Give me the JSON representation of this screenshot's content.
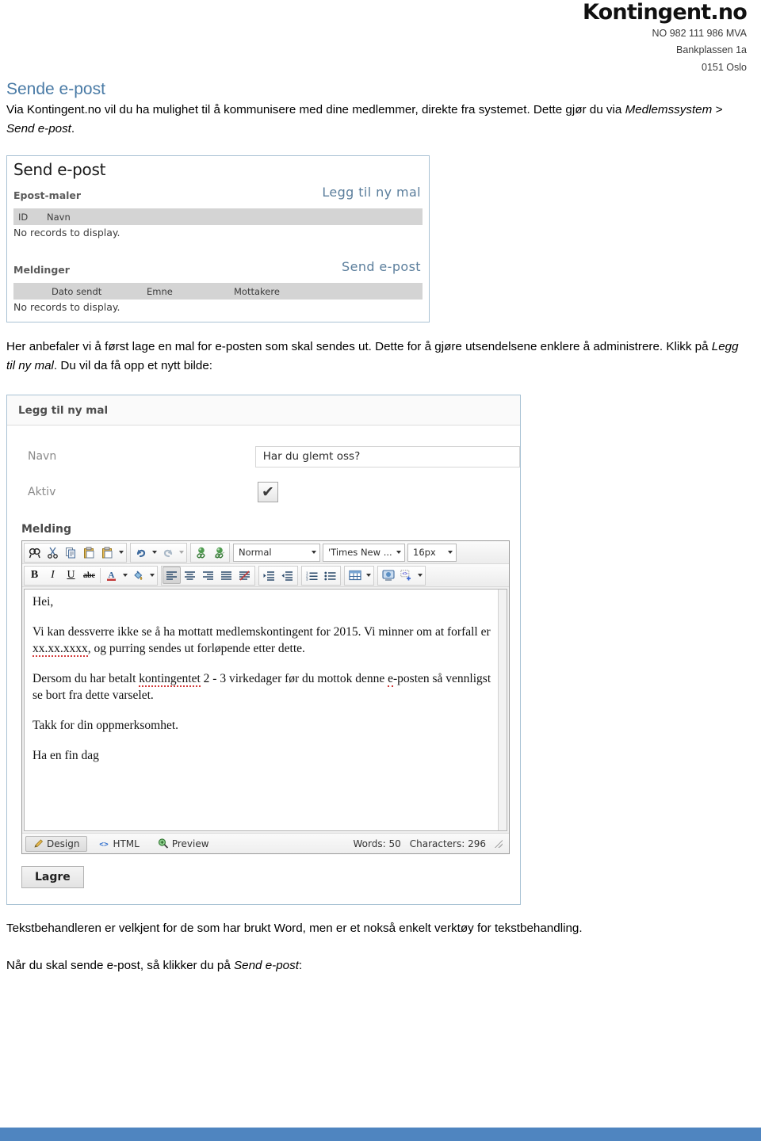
{
  "header": {
    "logo_text": "Kontingent.no",
    "org_number": "NO 982 111 986 MVA",
    "address_line": "Bankplassen 1a",
    "postal_line": "0151 Oslo",
    "logo_color": "#111111"
  },
  "document": {
    "section_title": "Sende e-post",
    "intro_part1": "Via Kontingent.no vil du ha mulighet til å kommunisere med dine medlemmer, direkte fra systemet. Dette gjør du via ",
    "intro_italic": "Medlemssystem > Send e-post",
    "intro_part2": ".",
    "mid_part1": "Her anbefaler vi å først lage en mal for e-posten som skal sendes ut. Dette for å gjøre utsendelsene enklere å administrere. Klikk på ",
    "mid_italic": "Legg til ny mal",
    "mid_part2": ". Du vil da få opp et nytt bilde:",
    "close_part1": "Tekstbehandleren er velkjent for de som har brukt Word, men er et nokså enkelt verktøy for tekstbehandling.",
    "close2_part1": "Når du skal sende e-post, så klikker du på ",
    "close2_italic": "Send e-post",
    "close2_part2": ":",
    "heading_color": "#4a7ba6"
  },
  "screenshot_send_epost": {
    "title": "Send e-post",
    "templates_section_label": "Epost-maler",
    "add_template_link": "Legg til ny mal",
    "templates_columns": [
      "ID",
      "Navn"
    ],
    "templates_empty": "No records to display.",
    "messages_section_label": "Meldinger",
    "send_link": "Send e-post",
    "messages_columns": [
      "Dato sendt",
      "Emne",
      "Mottakere"
    ],
    "messages_empty": "No records to display.",
    "link_color": "#5b7e9c",
    "panel_border": "#a9c2d4",
    "grid_header_bg": "#d4d4d4"
  },
  "screenshot_ny_mal": {
    "panel_title": "Legg til ny mal",
    "field_navn_label": "Navn",
    "field_navn_value": "Har du glemt oss?",
    "field_aktiv_label": "Aktiv",
    "field_aktiv_checked": "✔",
    "message_label": "Melding",
    "toolbar_row1": [
      {
        "name": "find-icon",
        "title": "Find"
      },
      {
        "name": "cut-icon",
        "title": "Cut"
      },
      {
        "name": "copy-icon",
        "title": "Copy"
      },
      {
        "name": "paste-icon",
        "title": "Paste"
      },
      {
        "name": "paste-options-icon",
        "title": "Paste options"
      },
      {
        "name": "undo-icon",
        "title": "Undo"
      },
      {
        "name": "redo-icon",
        "title": "Redo"
      },
      {
        "name": "insert-link-icon",
        "title": "Insert link"
      },
      {
        "name": "remove-link-icon",
        "title": "Remove link"
      }
    ],
    "dropdown_style": "Normal",
    "dropdown_font": "'Times New ...",
    "dropdown_size": "16px",
    "toolbar_row2": [
      {
        "name": "bold-icon",
        "glyph": "B"
      },
      {
        "name": "italic-icon",
        "glyph": "I"
      },
      {
        "name": "underline-icon",
        "glyph": "U"
      },
      {
        "name": "strikethrough-icon",
        "glyph": "abc"
      },
      {
        "name": "font-color-icon",
        "glyph": "A"
      },
      {
        "name": "highlight-color-icon",
        "glyph": "fill"
      },
      {
        "name": "align-left-icon",
        "glyph": "align-left"
      },
      {
        "name": "align-center-icon",
        "glyph": "align-center"
      },
      {
        "name": "align-right-icon",
        "glyph": "align-right"
      },
      {
        "name": "align-justify-icon",
        "glyph": "align-justify"
      },
      {
        "name": "remove-format-icon",
        "glyph": "remove-format"
      },
      {
        "name": "indent-icon",
        "glyph": "indent"
      },
      {
        "name": "outdent-icon",
        "glyph": "outdent"
      },
      {
        "name": "numbered-list-icon",
        "glyph": "ol"
      },
      {
        "name": "bullet-list-icon",
        "glyph": "ul"
      },
      {
        "name": "insert-table-icon",
        "glyph": "table"
      },
      {
        "name": "insert-image-icon",
        "glyph": "image"
      },
      {
        "name": "insert-code-icon",
        "glyph": "code"
      }
    ],
    "editor_paragraphs": [
      "Hei,",
      "Vi kan dessverre ikke se å ha mottatt medlemskontingent for 2015. Vi minner om at forfall er xx.xx.xxxx, og purring sendes ut forløpende etter dette.",
      "Dersom du har betalt kontingentet 2 - 3 virkedager før du mottok denne e-posten så vennligst se bort fra dette varselet.",
      "Takk for din oppmerksomhet.",
      "Ha en fin dag"
    ],
    "editor_p2_a": "Vi kan dessverre ikke se å ha mottatt medlemskontingent for 2015. Vi minner om at forfall er ",
    "editor_p2_sq": "xx.xx.xxxx",
    "editor_p2_b": ", og purring sendes ut forløpende etter dette.",
    "editor_p3_a": "Dersom du har betalt ",
    "editor_p3_sq": "kontingentet",
    "editor_p3_b": " 2 - 3 virkedager før du mottok denne ",
    "editor_p3_sq2": "e",
    "editor_p3_c": "-posten så vennligst se bort fra dette varselet.",
    "status_design": "Design",
    "status_html": "HTML",
    "status_preview": "Preview",
    "status_words": "Words: 50",
    "status_characters": "Characters: 296",
    "save_button": "Lagre"
  },
  "footer": {
    "bar_color": "#4f85c0"
  }
}
